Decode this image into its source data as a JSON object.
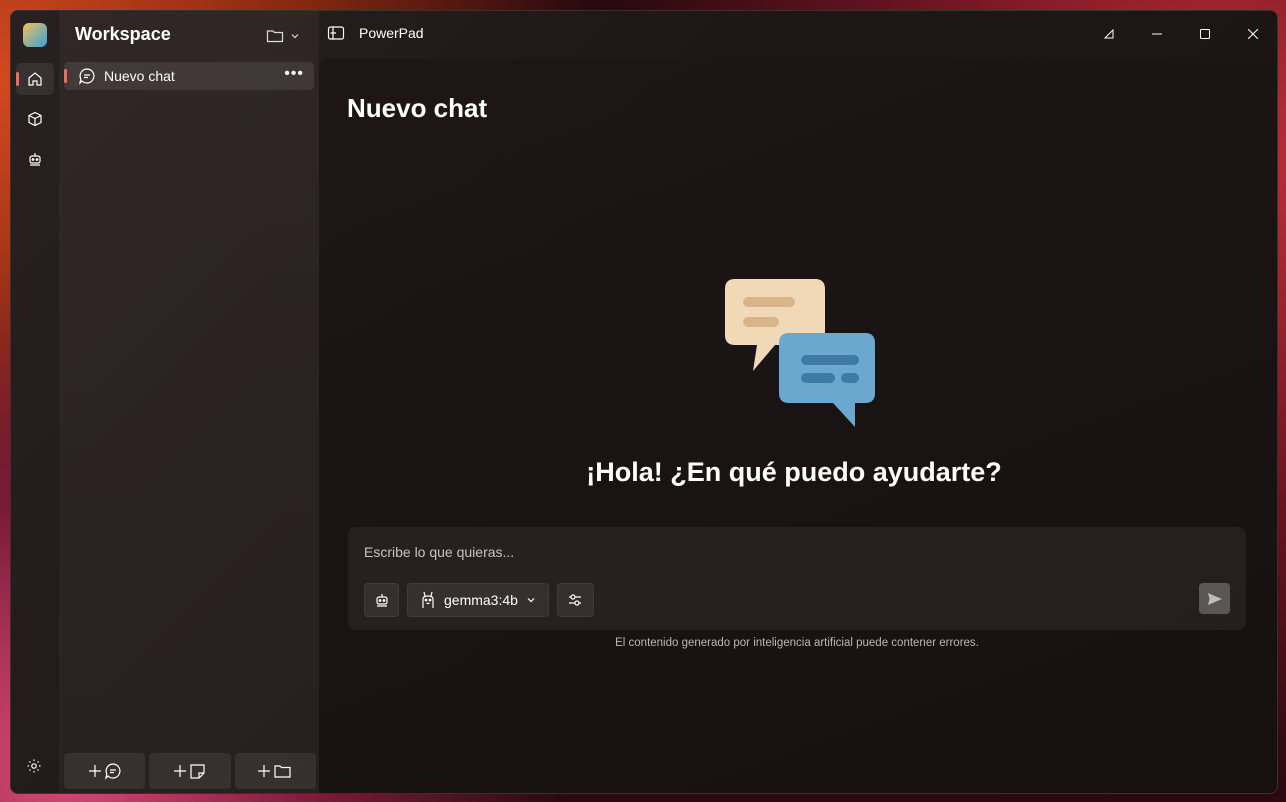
{
  "sidebar": {
    "workspace_title": "Workspace",
    "chat_item_label": "Nuevo chat"
  },
  "titlebar": {
    "app_name": "PowerPad"
  },
  "main": {
    "page_title": "Nuevo chat",
    "greeting": "¡Hola! ¿En qué puedo ayudarte?",
    "composer_placeholder": "Escribe lo que quieras...",
    "model_name": "gemma3:4b",
    "disclaimer": "El contenido generado por inteligencia artificial puede contener errores."
  },
  "colors": {
    "accent": "#e8715a"
  },
  "icons": [
    "home-icon",
    "cube-icon",
    "robot-icon",
    "settings-icon",
    "folder-icon",
    "chevron-down-icon",
    "chat-icon",
    "more-icon",
    "panel-icon",
    "minimize-icon",
    "maximize-icon",
    "close-icon",
    "send-icon",
    "sliders-icon",
    "llama-icon",
    "add-chat-icon",
    "add-note-icon",
    "add-folder-icon"
  ]
}
